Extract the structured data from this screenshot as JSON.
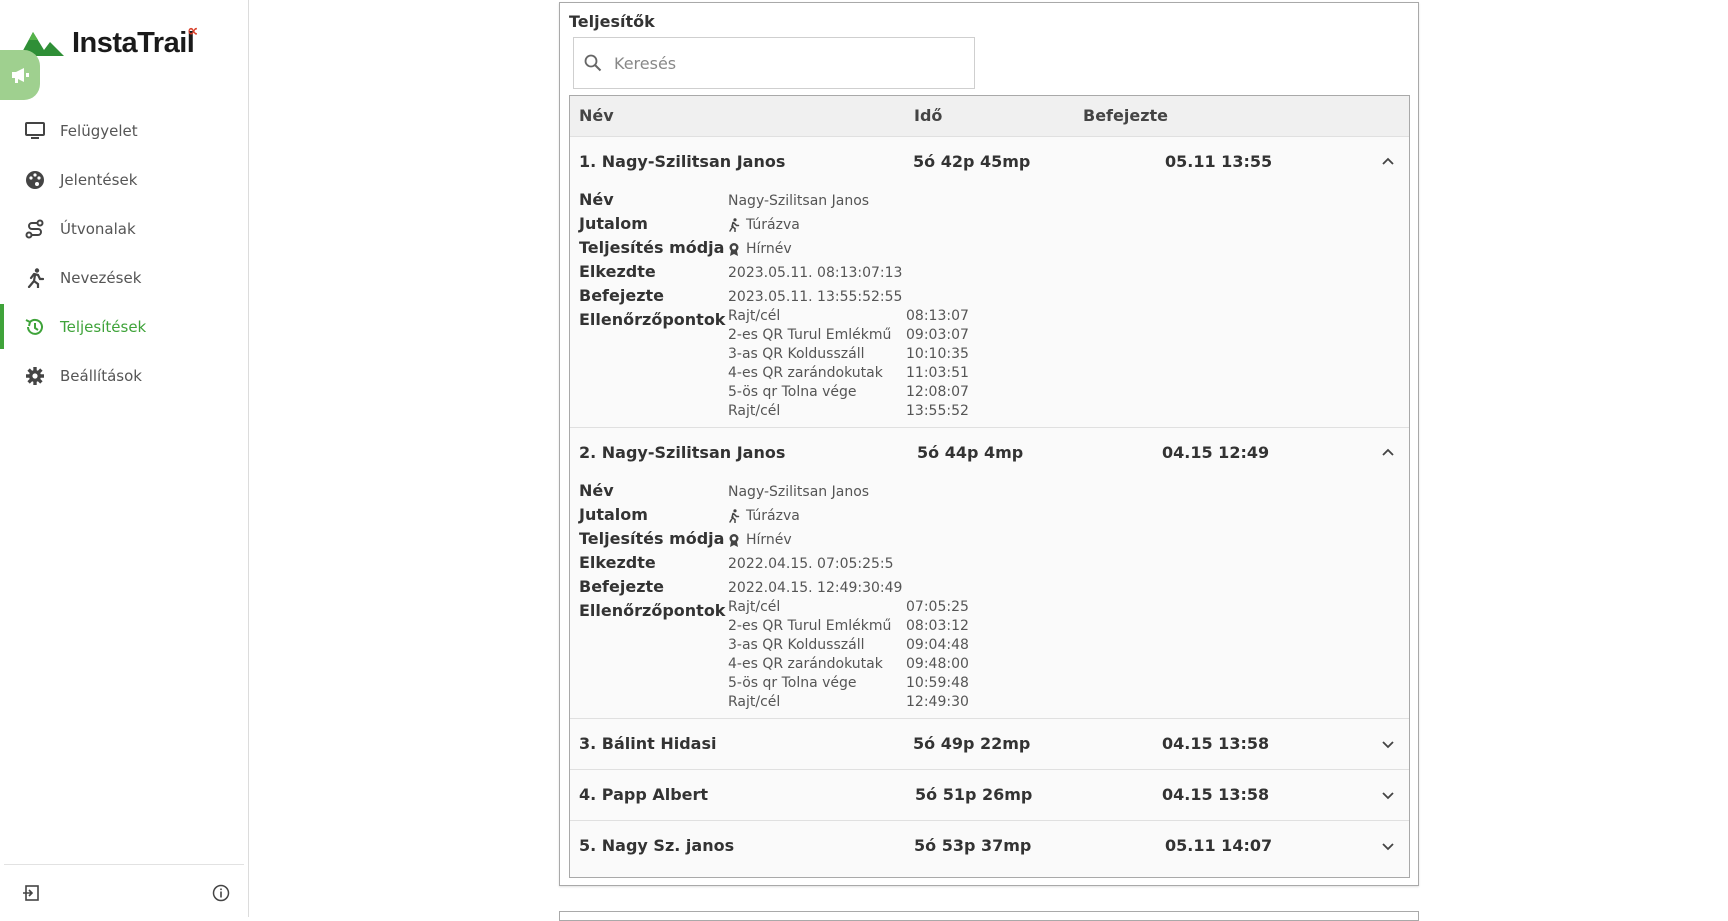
{
  "brand": {
    "name": "InstaTrail",
    "suffix": "∝",
    "logo_icon": "mountain-logo-icon"
  },
  "sidebar": {
    "announce_icon": "megaphone-icon",
    "items": [
      {
        "label": "Felügyelet",
        "icon": "monitor-icon",
        "active": false
      },
      {
        "label": "Jelentések",
        "icon": "palette-icon",
        "active": false
      },
      {
        "label": "Útvonalak",
        "icon": "route-icon",
        "active": false
      },
      {
        "label": "Nevezések",
        "icon": "runner-icon",
        "active": false
      },
      {
        "label": "Teljesítések",
        "icon": "history-icon",
        "active": true
      },
      {
        "label": "Beállítások",
        "icon": "gear-icon",
        "active": false
      }
    ],
    "footer": {
      "logout_icon": "logout-icon",
      "info_icon": "info-icon"
    }
  },
  "colors": {
    "accent": "#3fa33a",
    "announce_bg": "#9fd08f",
    "brand_alpha": "#d9412b"
  },
  "panel": {
    "title": "Teljesítők",
    "search": {
      "placeholder": "Keresés",
      "value": ""
    },
    "columns": [
      "Név",
      "Idő",
      "Befejezte"
    ],
    "detail_labels": {
      "name": "Név",
      "reward": "Jutalom",
      "mode": "Teljesítés módja",
      "started": "Elkezdte",
      "finished": "Befejezte",
      "checkpoints": "Ellenőrzőpontok"
    },
    "rows": [
      {
        "title": "1. Nagy-Szilitsan Janos",
        "time": "5ó 42p 45mp",
        "finished": "05.11 13:55",
        "expanded": true,
        "details": {
          "name": "Nagy-Szilitsan Janos",
          "reward": "Túrázva",
          "mode": "Hírnév",
          "started": "2023.05.11. 08:13:07:13",
          "finished": "2023.05.11. 13:55:52:55",
          "checkpoints": [
            {
              "name": "Rajt/cél",
              "time": "08:13:07"
            },
            {
              "name": "2-es QR Turul Emlékmű",
              "time": "09:03:07"
            },
            {
              "name": "3-as QR Koldusszáll",
              "time": "10:10:35"
            },
            {
              "name": "4-es QR zarándokutak",
              "time": "11:03:51"
            },
            {
              "name": "5-ös qr Tolna vége",
              "time": "12:08:07"
            },
            {
              "name": "Rajt/cél",
              "time": "13:55:52"
            }
          ]
        }
      },
      {
        "title": "2. Nagy-Szilitsan Janos",
        "time": "5ó 44p 4mp",
        "finished": "04.15 12:49",
        "expanded": true,
        "details": {
          "name": "Nagy-Szilitsan Janos",
          "reward": "Túrázva",
          "mode": "Hírnév",
          "started": "2022.04.15. 07:05:25:5",
          "finished": "2022.04.15. 12:49:30:49",
          "checkpoints": [
            {
              "name": "Rajt/cél",
              "time": "07:05:25"
            },
            {
              "name": "2-es QR Turul Emlékmű",
              "time": "08:03:12"
            },
            {
              "name": "3-as QR Koldusszáll",
              "time": "09:04:48"
            },
            {
              "name": "4-es QR zarándokutak",
              "time": "09:48:00"
            },
            {
              "name": "5-ös qr Tolna vége",
              "time": "10:59:48"
            },
            {
              "name": "Rajt/cél",
              "time": "12:49:30"
            }
          ]
        }
      },
      {
        "title": "3. Bálint Hidasi",
        "time": "5ó 49p 22mp",
        "finished": "04.15 13:58",
        "expanded": false
      },
      {
        "title": "4. Papp Albert",
        "time": "5ó 51p 26mp",
        "finished": "04.15 13:58",
        "expanded": false
      },
      {
        "title": "5. Nagy Sz. janos",
        "time": "5ó 53p 37mp",
        "finished": "05.11 14:07",
        "expanded": false
      }
    ]
  }
}
